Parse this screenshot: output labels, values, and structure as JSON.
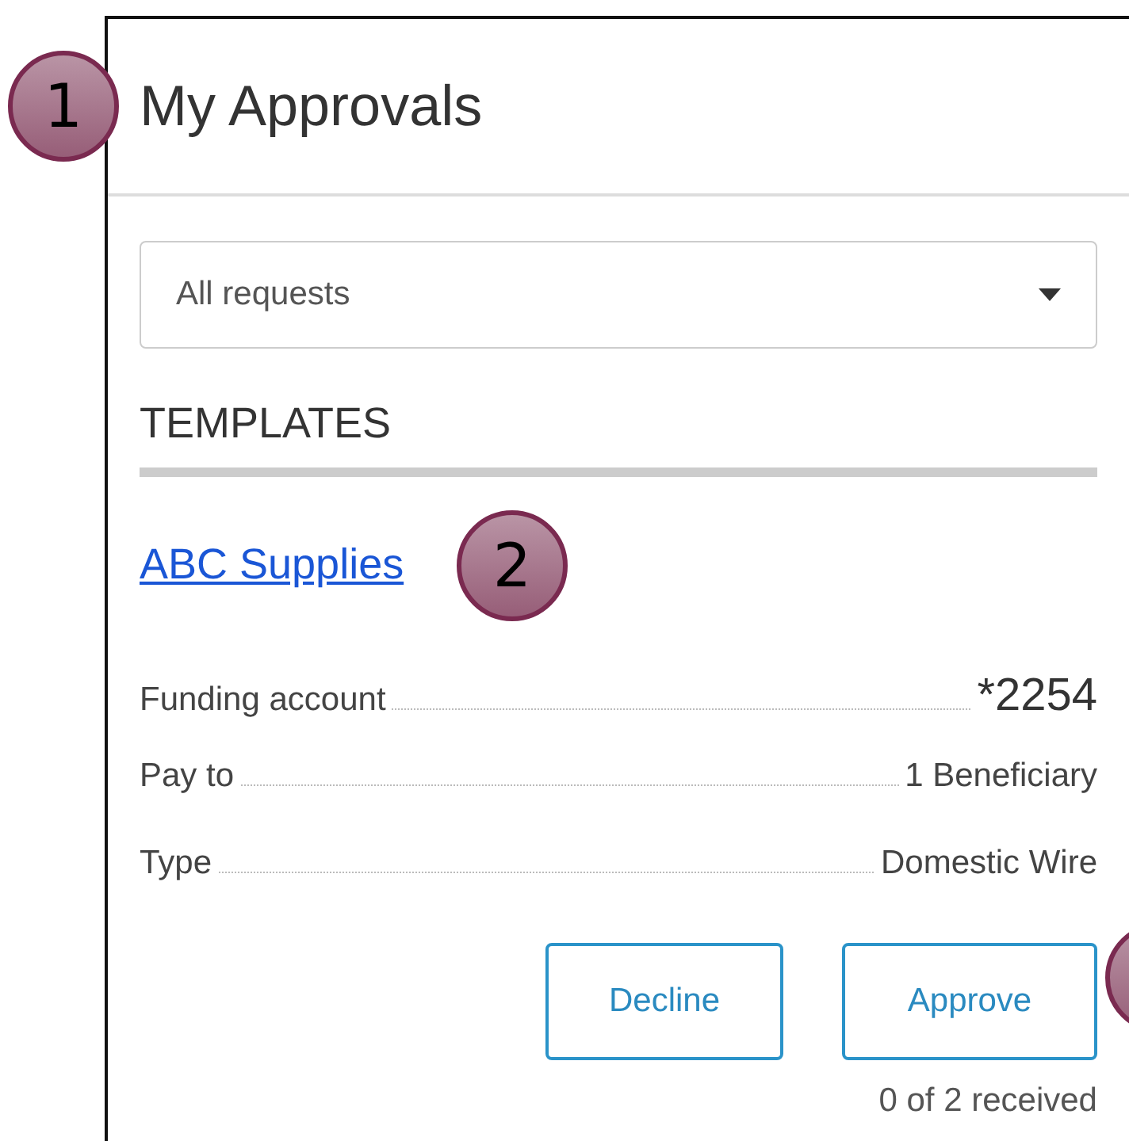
{
  "callouts": [
    {
      "kind": "numbered",
      "label": "1"
    },
    {
      "kind": "numbered",
      "label": "2"
    },
    {
      "kind": "cut"
    }
  ],
  "panel": {
    "title": "My Approvals"
  },
  "filter": {
    "value": "All requests"
  },
  "section": {
    "heading": "TEMPLATES"
  },
  "template": {
    "name": "ABC Supplies",
    "details": [
      {
        "label": "Funding account",
        "value": "*2254",
        "kind": "large"
      },
      {
        "label": "Pay to",
        "value": "1 Beneficiary",
        "kind": "normal"
      },
      {
        "label": "Type",
        "value": "Domestic Wire",
        "kind": "normal"
      }
    ],
    "buttons": [
      "Decline",
      "Approve"
    ],
    "status": "0 of 2 received"
  }
}
